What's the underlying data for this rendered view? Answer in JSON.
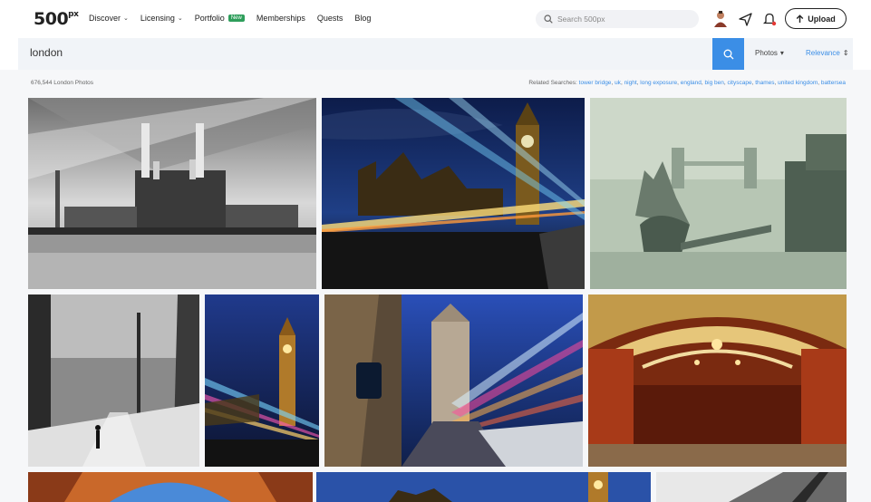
{
  "header": {
    "logo": "500",
    "logo_sup": "px",
    "nav": [
      {
        "label": "Discover",
        "dropdown": true
      },
      {
        "label": "Licensing",
        "dropdown": true
      },
      {
        "label": "Portfolio",
        "badge": "New"
      },
      {
        "label": "Memberships"
      },
      {
        "label": "Quests"
      },
      {
        "label": "Blog"
      }
    ],
    "search_placeholder": "Search 500px",
    "upload_label": "Upload"
  },
  "search": {
    "query": "london",
    "filter_type": "Photos",
    "sort": "Relevance"
  },
  "results": {
    "count_text": "676,544 London Photos",
    "related_label": "Related Searches:",
    "related": [
      "tower bridge",
      "uk",
      "night",
      "long exposure",
      "england",
      "big ben",
      "cityscape",
      "thames",
      "united kingdom",
      "battersea"
    ]
  },
  "colors": {
    "accent": "#3b8ee6",
    "badge": "#2e9e5b"
  }
}
